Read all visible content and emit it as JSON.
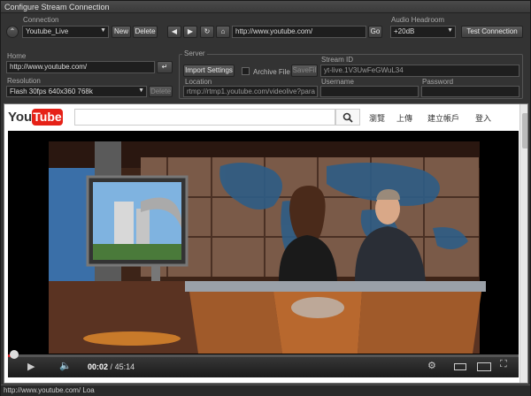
{
  "window": {
    "title": "Configure Stream Connection"
  },
  "connection": {
    "label": "Connection",
    "selected": "Youtube_Live",
    "new_label": "New",
    "delete_label": "Delete"
  },
  "navbar": {
    "url": "http://www.youtube.com/",
    "go_label": "Go"
  },
  "audio": {
    "label": "Audio Headroom",
    "selected": "+20dB",
    "test_label": "Test Connection"
  },
  "home": {
    "label": "Home",
    "value": "http://www.youtube.com/"
  },
  "resolution": {
    "label": "Resolution",
    "selected": "Flash 30fps 640x360 768k",
    "delete_label": "Delete"
  },
  "server": {
    "label": "Server",
    "import_label": "Import Settings",
    "archive_label": "Archive File",
    "savefile_label": "SaveFil",
    "location_label": "Location",
    "location_value": "rtmp://rtmp1.youtube.com/videolive?para",
    "stream_id_label": "Stream ID",
    "stream_id_value": "yt-live.1V3UwFeGWuL34",
    "username_label": "Username",
    "password_label": "Password"
  },
  "youtube": {
    "logo_you": "You",
    "logo_tube": "Tube",
    "nav": [
      "瀏覽",
      "上傳",
      "建立帳戶",
      "登入"
    ]
  },
  "player": {
    "current_time": "00:02",
    "total_time": "45:14",
    "progress": 0.0007
  },
  "status": {
    "text": "http://www.youtube.com/ Loa"
  },
  "colors": {
    "accent": "#cc181e",
    "yt_red": "#e62117"
  }
}
